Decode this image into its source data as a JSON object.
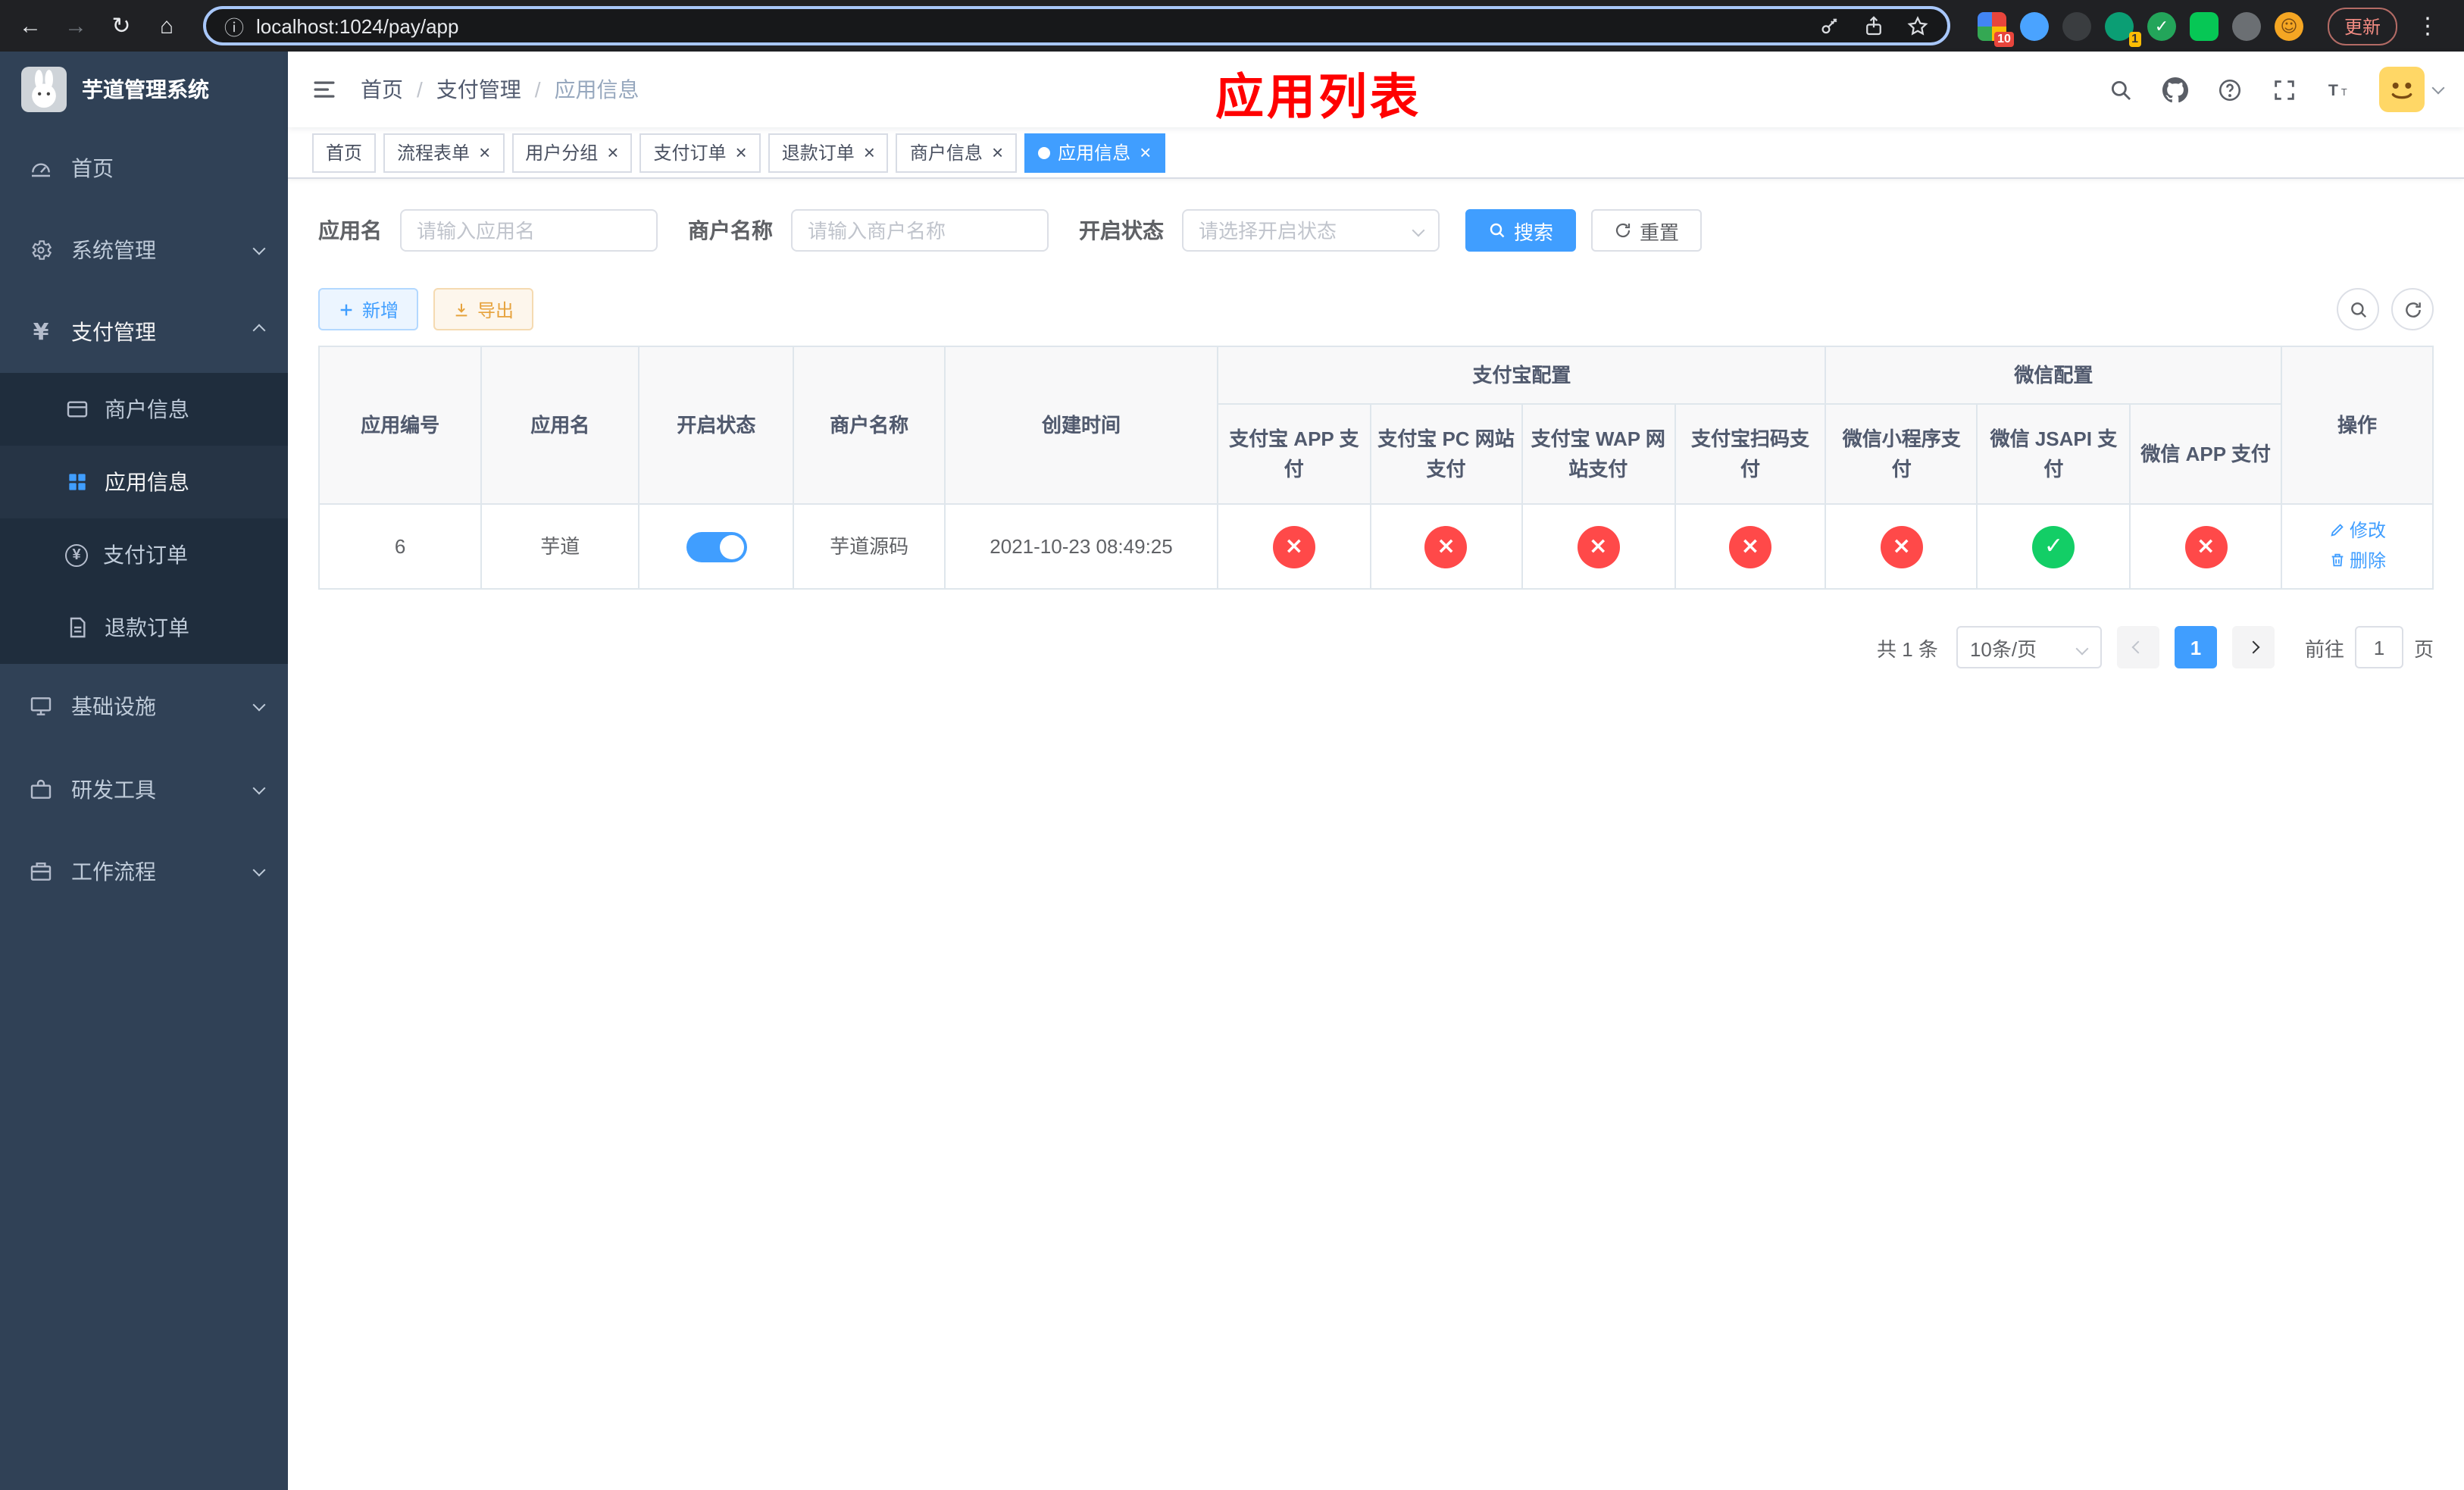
{
  "browser": {
    "url": "localhost:1024/pay/app",
    "update_label": "更新",
    "extension_badges": {
      "grid": "10",
      "leaf": "1"
    }
  },
  "sidebar": {
    "logo_title": "芋道管理系统",
    "menu": {
      "home": "首页",
      "system": "系统管理",
      "payment": "支付管理",
      "merchant_info": "商户信息",
      "app_info": "应用信息",
      "pay_order": "支付订单",
      "refund_order": "退款订单",
      "infrastructure": "基础设施",
      "dev_tools": "研发工具",
      "workflow": "工作流程"
    },
    "active_item": "应用信息"
  },
  "header": {
    "breadcrumb": {
      "home": "首页",
      "section": "支付管理",
      "current": "应用信息"
    },
    "annotation": "应用列表"
  },
  "tabs": [
    {
      "label": "首页",
      "closable": false,
      "active": false
    },
    {
      "label": "流程表单",
      "closable": true,
      "active": false
    },
    {
      "label": "用户分组",
      "closable": true,
      "active": false
    },
    {
      "label": "支付订单",
      "closable": true,
      "active": false
    },
    {
      "label": "退款订单",
      "closable": true,
      "active": false
    },
    {
      "label": "商户信息",
      "closable": true,
      "active": false
    },
    {
      "label": "应用信息",
      "closable": true,
      "active": true
    }
  ],
  "filters": {
    "app_name_label": "应用名",
    "app_name_placeholder": "请输入应用名",
    "merchant_label": "商户名称",
    "merchant_placeholder": "请输入商户名称",
    "status_label": "开启状态",
    "status_placeholder": "请选择开启状态",
    "search_label": "搜索",
    "reset_label": "重置"
  },
  "toolbar": {
    "add_label": "新增",
    "export_label": "导出"
  },
  "table": {
    "headers": {
      "app_id": "应用编号",
      "app_name": "应用名",
      "status": "开启状态",
      "merchant_name": "商户名称",
      "created_at": "创建时间",
      "alipay_group": "支付宝配置",
      "wechat_group": "微信配置",
      "alipay_app": "支付宝 APP 支付",
      "alipay_pc": "支付宝 PC 网站支付",
      "alipay_wap": "支付宝 WAP 网站支付",
      "alipay_qr": "支付宝扫码支付",
      "wx_mini": "微信小程序支付",
      "wx_jsapi": "微信 JSAPI 支付",
      "wx_app": "微信 APP 支付",
      "actions": "操作"
    },
    "row": {
      "id": "6",
      "name": "芋道",
      "enabled": true,
      "merchant": "芋道源码",
      "created": "2021-10-23 08:49:25",
      "configs": {
        "alipay_app": false,
        "alipay_pc": false,
        "alipay_wap": false,
        "alipay_qr": false,
        "wx_mini": false,
        "wx_jsapi": true,
        "wx_app": false
      },
      "edit_label": "修改",
      "delete_label": "删除"
    }
  },
  "pagination": {
    "total": "共 1 条",
    "page_size": "10条/页",
    "page": "1",
    "goto_label": "前往",
    "goto_value": "1",
    "unit": "页"
  },
  "colors": {
    "accent": "#409eff",
    "success": "#13ce66",
    "danger": "#ff4949",
    "warning": "#e6a23c",
    "annotation": "#ff0000",
    "sidebar_bg": "#304156",
    "submenu_bg": "#1f2d3d"
  }
}
